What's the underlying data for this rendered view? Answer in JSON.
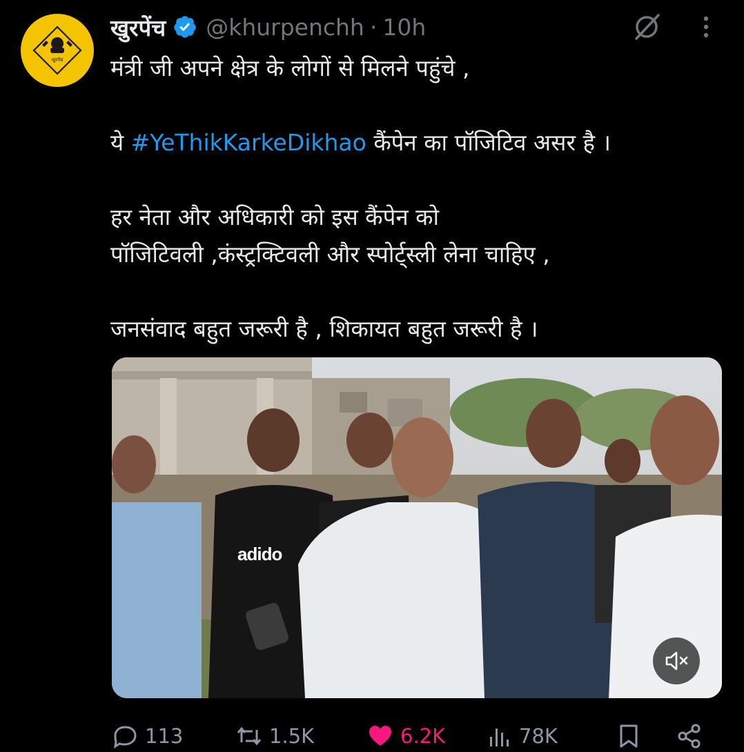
{
  "tweet": {
    "display_name": "खुरपेंच",
    "handle": "@khurpenchh",
    "separator": "·",
    "time": "10h",
    "avatar_text": "खुरपेंच",
    "text_part1": "मंत्री जी अपने क्षेत्र के लोगों से मिलने पहुंचे ,\n\nये ",
    "hashtag": "#YeThikKarkeDikhao",
    "text_part2": " कैंपेन का पॉजिटिव असर है ।\n\nहर नेता और अधिकारी को इस कैंपेन को\nपॉजिटिवली ,कंस्ट्रक्टिवली और स्पोर्ट्स्ली लेना चाहिए ,\n\nजनसंवाद बहुत जरूरी है , शिकायत बहुत जरूरी है ।",
    "shirt_text": "adido"
  },
  "actions": {
    "replies": "113",
    "reposts": "1.5K",
    "likes": "6.2K",
    "views": "78K"
  },
  "icons": {
    "verified": "verified-badge-icon",
    "grok": "grok-icon",
    "more": "more-icon",
    "reply": "reply-icon",
    "repost": "repost-icon",
    "like": "heart-icon",
    "views": "views-icon",
    "bookmark": "bookmark-icon",
    "share": "share-icon",
    "mute": "muted-speaker-icon"
  },
  "colors": {
    "background": "#000000",
    "text": "#e7e9ea",
    "secondary": "#71767b",
    "link": "#1d9bf0",
    "like": "#f91880",
    "avatar": "#f5c400"
  }
}
